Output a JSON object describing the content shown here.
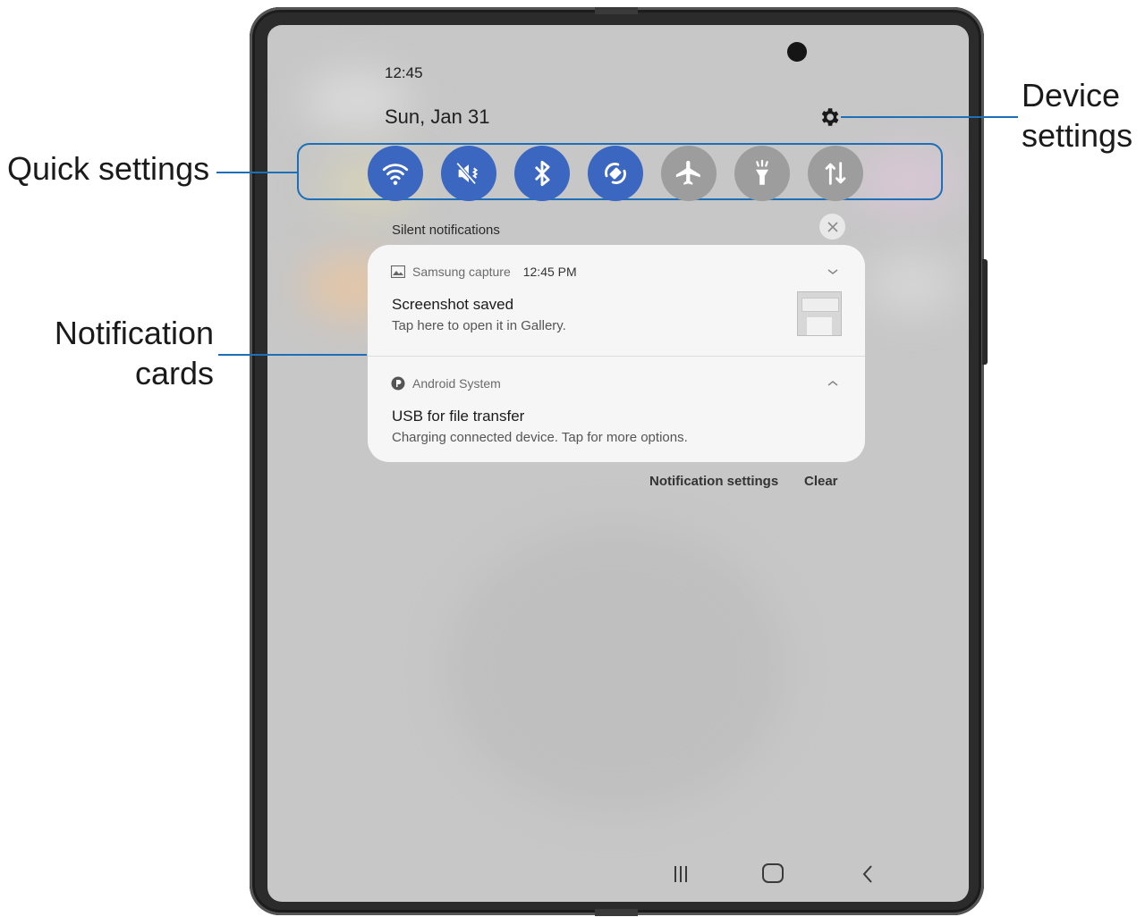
{
  "status": {
    "time": "12:45",
    "date": "Sun, Jan 31"
  },
  "header": {
    "settings_icon": "gear-icon"
  },
  "quick_settings": {
    "tiles": [
      {
        "icon": "wifi-icon",
        "state": "on"
      },
      {
        "icon": "mute-icon",
        "state": "on"
      },
      {
        "icon": "bluetooth-icon",
        "state": "on"
      },
      {
        "icon": "auto-rotate-icon",
        "state": "on"
      },
      {
        "icon": "airplane-icon",
        "state": "off"
      },
      {
        "icon": "flashlight-icon",
        "state": "off"
      },
      {
        "icon": "mobile-data-icon",
        "state": "off"
      }
    ]
  },
  "notifications": {
    "section_label": "Silent notifications",
    "items": [
      {
        "app": "Samsung capture",
        "time": "12:45 PM",
        "title": "Screenshot saved",
        "body": "Tap here to open it in Gallery."
      },
      {
        "app": "Android System",
        "title": "USB for file transfer",
        "body": "Charging connected device. Tap for more options."
      }
    ],
    "actions": {
      "settings": "Notification settings",
      "clear": "Clear"
    }
  },
  "callouts": {
    "quick_settings": "Quick settings",
    "notification_cards": [
      "Notification",
      "cards"
    ],
    "device_settings": [
      "Device",
      "settings"
    ]
  },
  "colors": {
    "accent": "#1d6fb8",
    "tile_on": "#3b67c0",
    "tile_off": "#9d9d9d"
  }
}
